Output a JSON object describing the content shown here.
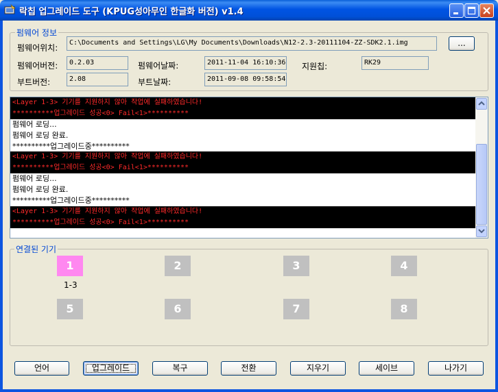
{
  "window": {
    "title": "락칩 업그레이드 도구 (KPUG성아무인 한글화 버전) v1.4"
  },
  "firmware_info": {
    "group_label": "펌웨어 정보",
    "path_label": "펌웨어위치:",
    "path_value": "C:\\Documents and Settings\\LG\\My Documents\\Downloads\\N12-2.3-20111104-ZZ-SDK2.1.img",
    "browse_label": "...",
    "fw_version_label": "펌웨어버전:",
    "fw_version_value": "0.2.03",
    "fw_date_label": "펌웨어날짜:",
    "fw_date_value": "2011-11-04 16:10:36",
    "chip_label": "지원칩:",
    "chip_value": "RK29",
    "boot_version_label": "부트버전:",
    "boot_version_value": "2.08",
    "boot_date_label": "부트날짜:",
    "boot_date_value": "2011-09-08 09:58:54"
  },
  "log": {
    "lines": [
      {
        "text": "<Layer 1-3> 기기를 지원하지 않아 작업에 실패하였습니다!",
        "type": "err"
      },
      {
        "text": "**********업그레이드 성공<0> Fail<1>**********",
        "type": "err"
      },
      {
        "text": "펌웨어 로딩...",
        "type": "ok"
      },
      {
        "text": "펌웨어 로딩 완료.",
        "type": "ok"
      },
      {
        "text": "**********업그레이드중**********",
        "type": "ok"
      },
      {
        "text": "<Layer 1-3> 기기를 지원하지 않아 작업에 실패하였습니다!",
        "type": "err"
      },
      {
        "text": "**********업그레이드 성공<0> Fail<1>**********",
        "type": "err"
      },
      {
        "text": "펌웨어 로딩...",
        "type": "ok"
      },
      {
        "text": "펌웨어 로딩 완료.",
        "type": "ok"
      },
      {
        "text": "**********업그레이드중**********",
        "type": "ok"
      },
      {
        "text": "<Layer 1-3> 기기를 지원하지 않아 작업에 실패하였습니다!",
        "type": "err"
      },
      {
        "text": "**********업그레이드 성공<0> Fail<1>**********",
        "type": "err"
      }
    ]
  },
  "devices": {
    "group_label": "연결된 기기",
    "slots": [
      {
        "label": "1",
        "active": true,
        "sub": "1-3"
      },
      {
        "label": "2",
        "active": false,
        "sub": ""
      },
      {
        "label": "3",
        "active": false,
        "sub": ""
      },
      {
        "label": "4",
        "active": false,
        "sub": ""
      },
      {
        "label": "5",
        "active": false,
        "sub": ""
      },
      {
        "label": "6",
        "active": false,
        "sub": ""
      },
      {
        "label": "7",
        "active": false,
        "sub": ""
      },
      {
        "label": "8",
        "active": false,
        "sub": ""
      }
    ],
    "active_color": "#ff88f0",
    "inactive_color": "#c0c0c0"
  },
  "buttons": {
    "language": "언어",
    "upgrade": "업그레이드",
    "restore": "복구",
    "switch": "전환",
    "erase": "지우기",
    "save": "세이브",
    "exit": "나가기"
  },
  "colors": {
    "titlebar": "#0054e3",
    "group_label": "#0046d5",
    "log_error_text": "#ff2a2a",
    "log_error_bg": "#000000"
  }
}
